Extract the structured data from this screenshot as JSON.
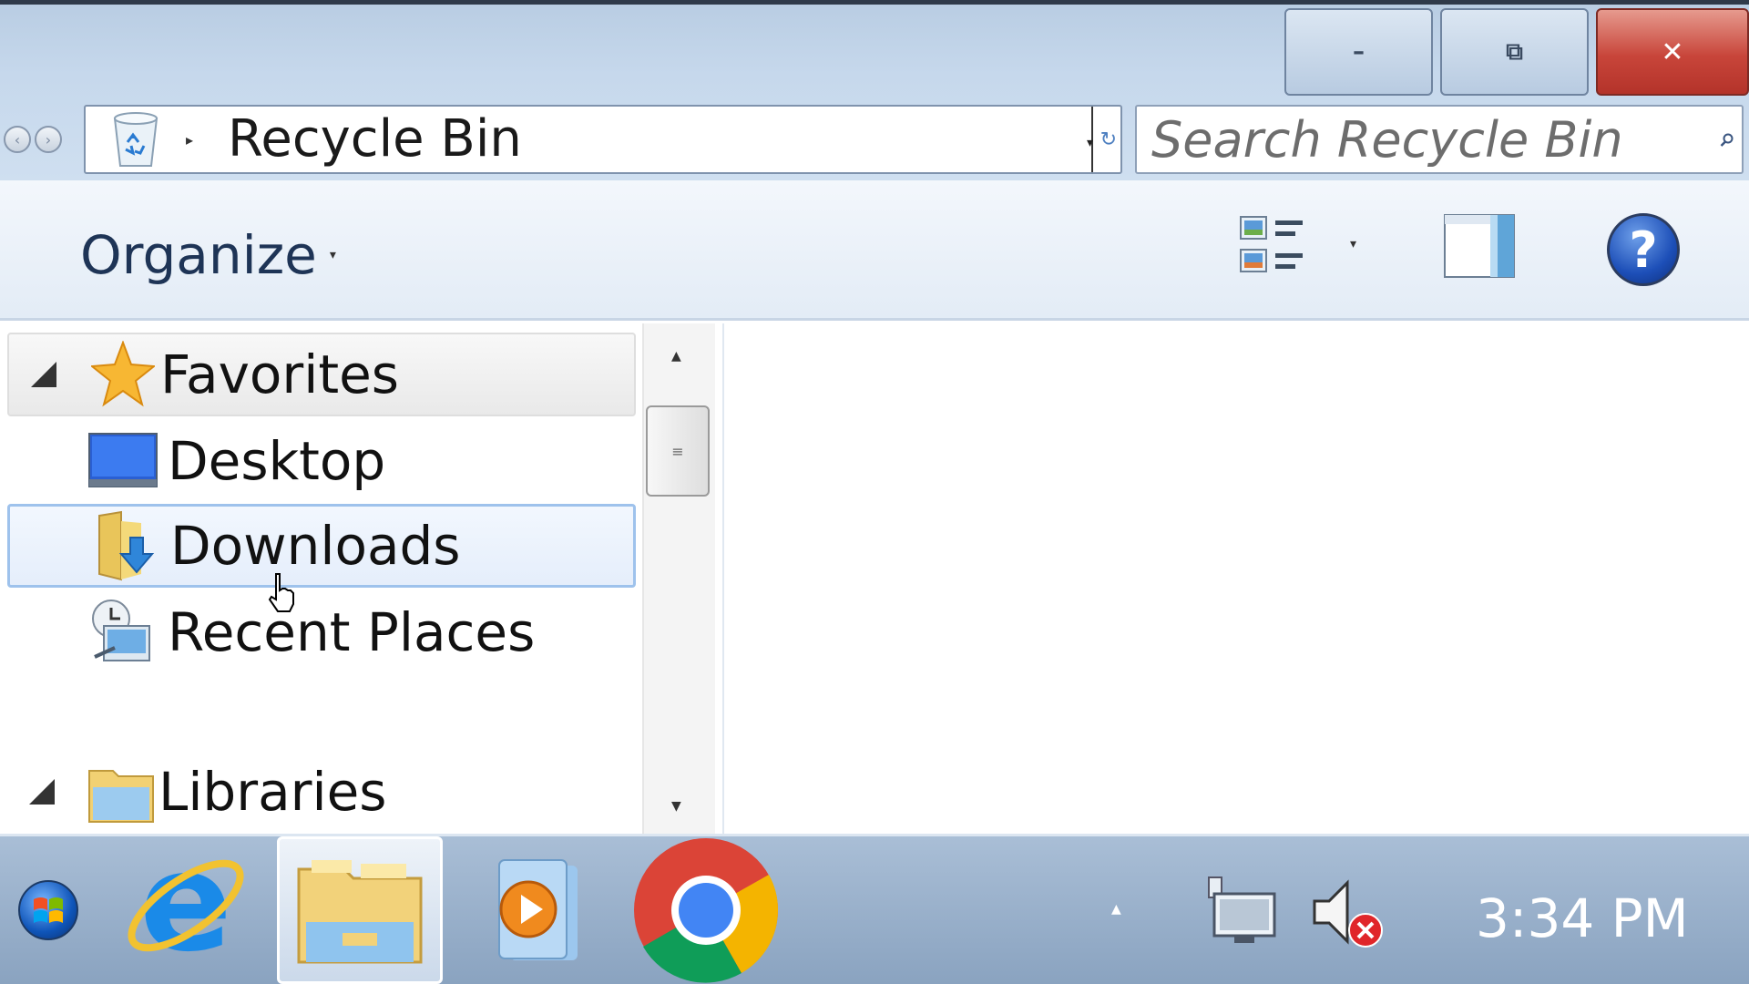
{
  "window": {
    "caption_buttons": {
      "minimize": "–",
      "restore": "⧉",
      "close": "✕"
    },
    "nav_buttons": {
      "back": "‹",
      "forward": "›"
    },
    "address": {
      "location": "Recycle Bin",
      "chevron": "▸",
      "dropdown": "▾",
      "refresh": "↻"
    },
    "search": {
      "placeholder": "Search Recycle Bin",
      "icon": "search-icon"
    }
  },
  "toolbar": {
    "organize_label": "Organize",
    "organize_caret": "▾",
    "views_caret": "▾",
    "help_label": "?"
  },
  "navigation": {
    "favorites": {
      "label": "Favorites",
      "icon": "star-icon"
    },
    "items": [
      {
        "label": "Desktop",
        "icon": "desktop-icon"
      },
      {
        "label": "Downloads",
        "icon": "downloads-folder-icon",
        "selected": true
      },
      {
        "label": "Recent Places",
        "icon": "recent-places-icon"
      }
    ],
    "libraries": {
      "label": "Libraries",
      "icon": "libraries-folder-icon"
    }
  },
  "scrollbar": {
    "up": "▲",
    "down": "▼",
    "grip": "≡"
  },
  "taskbar": {
    "pinned": [
      {
        "name": "internet-explorer",
        "icon": "internet-explorer-icon"
      },
      {
        "name": "windows-explorer",
        "icon": "folder-icon",
        "active": true
      },
      {
        "name": "media-player",
        "icon": "media-player-icon"
      },
      {
        "name": "chrome",
        "icon": "chrome-icon"
      }
    ],
    "tray": {
      "show_hidden": "▲",
      "network_icon": "network-icon",
      "volume_icon": "volume-muted-icon"
    },
    "clock": "3:34 PM"
  },
  "colors": {
    "close_button": "#c8453a",
    "selection_border": "#9ec2ec",
    "help_blue": "#1d4fb8",
    "taskbar": "#8aa3c0"
  }
}
